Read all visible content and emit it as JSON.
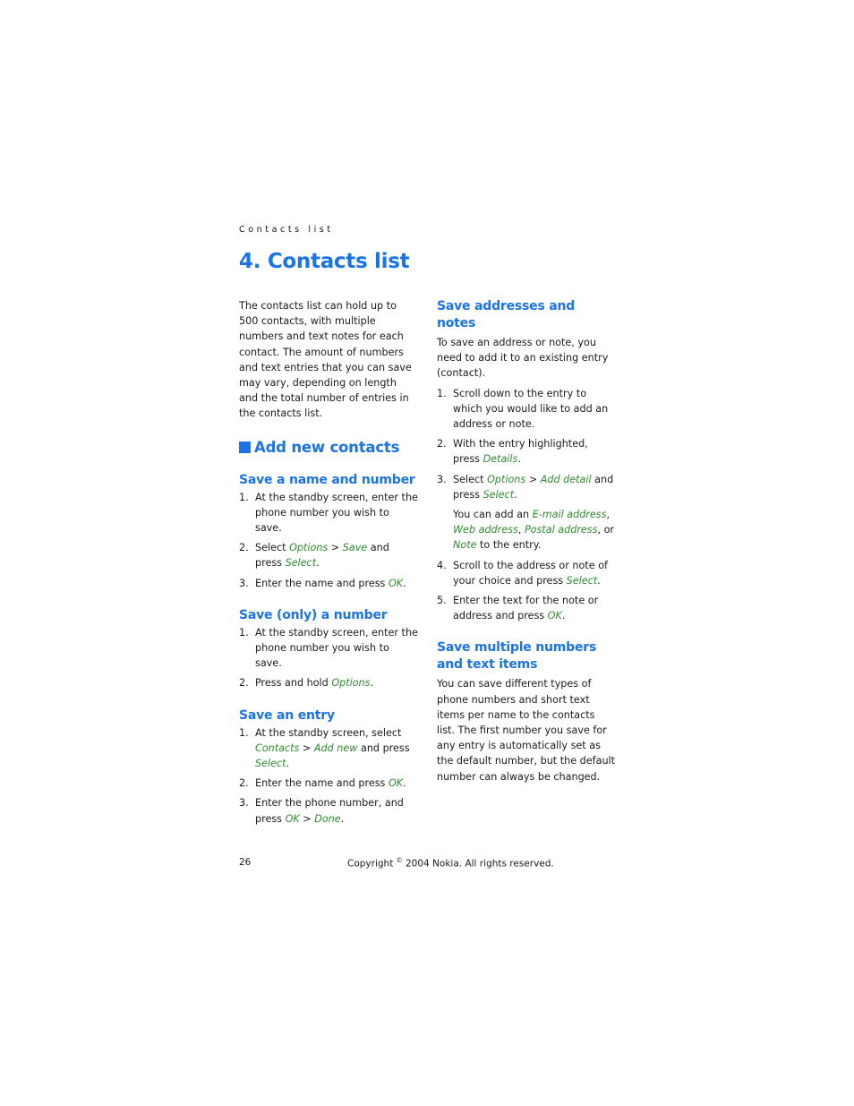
{
  "running_head": "Contacts list",
  "chapter_title": "4. Contacts list",
  "intro": "The contacts list can hold up to 500 contacts, with multiple numbers and text notes for each contact. The amount of numbers and text entries that you can save may vary, depending on length and the total number of entries in the contacts list.",
  "section": {
    "title": "Add new contacts",
    "icon": "blue-square-bullet"
  },
  "save_name_number": {
    "title": "Save a name and number",
    "steps": [
      {
        "n": "1.",
        "parts": [
          {
            "t": "At the standby screen, enter the phone number you wish to save."
          }
        ]
      },
      {
        "n": "2.",
        "parts": [
          {
            "t": "Select "
          },
          {
            "t": "Options",
            "g": true
          },
          {
            "t": " > "
          },
          {
            "t": "Save",
            "g": true
          },
          {
            "t": " and press "
          },
          {
            "t": "Select",
            "g": true
          },
          {
            "t": "."
          }
        ]
      },
      {
        "n": "3.",
        "parts": [
          {
            "t": "Enter the name and press "
          },
          {
            "t": "OK",
            "g": true
          },
          {
            "t": "."
          }
        ]
      }
    ]
  },
  "save_only_number": {
    "title": "Save (only) a number",
    "steps": [
      {
        "n": "1.",
        "parts": [
          {
            "t": "At the standby screen, enter the phone number you wish to save."
          }
        ]
      },
      {
        "n": "2.",
        "parts": [
          {
            "t": "Press and hold "
          },
          {
            "t": "Options",
            "g": true
          },
          {
            "t": "."
          }
        ]
      }
    ]
  },
  "save_entry": {
    "title": "Save an entry",
    "steps": [
      {
        "n": "1.",
        "parts": [
          {
            "t": "At the standby screen, select "
          },
          {
            "t": "Contacts",
            "g": true
          },
          {
            "t": " > "
          },
          {
            "t": "Add new",
            "g": true
          },
          {
            "t": " and press "
          },
          {
            "t": "Select",
            "g": true
          },
          {
            "t": "."
          }
        ]
      },
      {
        "n": "2.",
        "parts": [
          {
            "t": "Enter the name and press "
          },
          {
            "t": "OK",
            "g": true
          },
          {
            "t": "."
          }
        ]
      },
      {
        "n": "3.",
        "parts": [
          {
            "t": "Enter the phone number, and press "
          },
          {
            "t": "OK",
            "g": true
          },
          {
            "t": " > "
          },
          {
            "t": "Done",
            "g": true
          },
          {
            "t": "."
          }
        ]
      }
    ]
  },
  "save_addresses": {
    "title": "Save addresses and notes",
    "intro": "To save an address or note, you need to add it to an existing entry (contact).",
    "steps": [
      {
        "n": "1.",
        "parts": [
          {
            "t": "Scroll down to the entry to which you would like to add an address or note."
          }
        ]
      },
      {
        "n": "2.",
        "parts": [
          {
            "t": "With the entry highlighted, press "
          },
          {
            "t": "Details",
            "g": true
          },
          {
            "t": "."
          }
        ]
      },
      {
        "n": "3.",
        "parts": [
          {
            "t": "Select "
          },
          {
            "t": "Options",
            "g": true
          },
          {
            "t": " > "
          },
          {
            "t": "Add detail",
            "g": true
          },
          {
            "t": " and press "
          },
          {
            "t": "Select",
            "g": true
          },
          {
            "t": "."
          }
        ],
        "note": [
          {
            "t": "You can add an "
          },
          {
            "t": "E-mail address",
            "g": true
          },
          {
            "t": ", "
          },
          {
            "t": "Web address",
            "g": true
          },
          {
            "t": ", "
          },
          {
            "t": "Postal address",
            "g": true
          },
          {
            "t": ", or "
          },
          {
            "t": "Note",
            "g": true
          },
          {
            "t": " to the entry."
          }
        ]
      },
      {
        "n": "4.",
        "parts": [
          {
            "t": "Scroll to the address or note of your choice and press "
          },
          {
            "t": "Select",
            "g": true
          },
          {
            "t": "."
          }
        ]
      },
      {
        "n": "5.",
        "parts": [
          {
            "t": "Enter the text for the note or address and press "
          },
          {
            "t": "OK",
            "g": true
          },
          {
            "t": "."
          }
        ]
      }
    ]
  },
  "save_multiple": {
    "title": "Save multiple numbers and text items",
    "body": "You can save different types of phone numbers and short text items per name to the contacts list. The first number you save for any entry is automatically set as the default number, but the default number can always be changed."
  },
  "footer": {
    "page_number": "26",
    "copyright_prefix": "Copyright",
    "copyright_symbol": "©",
    "copyright_rest": "2004 Nokia. All rights reserved."
  },
  "colors": {
    "heading_blue": "#1a73e8",
    "ui_term_green": "#2e8b2e",
    "body_text": "#1a1a1a"
  }
}
